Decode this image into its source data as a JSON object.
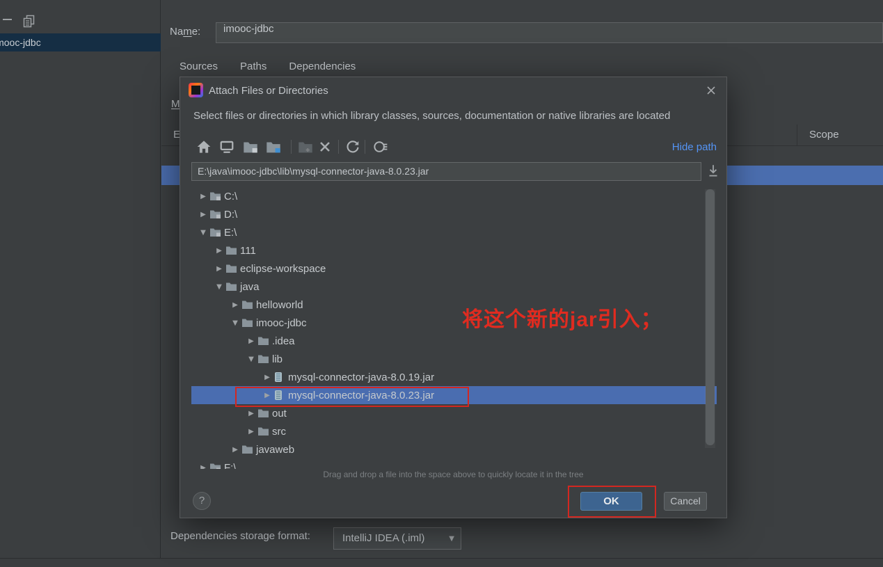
{
  "colors": {
    "background": "#3c3f41",
    "selection_blue": "#4a6db0",
    "background_row_blue": "#4b6eaf",
    "left_selection_navy": "#152e44",
    "ok_button_blue": "#3d6490",
    "link_blue": "#5494f5",
    "annotation_red": "#d32720",
    "input_background": "#45494a"
  },
  "left_panel": {
    "toolbar": {
      "minus_icon": "remove",
      "copy_icon": "copy"
    },
    "selected_item": "imooc-jdbc"
  },
  "library_editor": {
    "name_label": {
      "pre": "Na",
      "mnemonic": "m",
      "post": "e:"
    },
    "name_value": "imooc-jdbc",
    "tabs": [
      {
        "label": "Sources"
      },
      {
        "label": "Paths"
      },
      {
        "label": "Dependencies"
      }
    ],
    "clipped_module_label": "M",
    "clipped_export_label": "E",
    "scope_header": "Scope",
    "storage_format_label": "Dependencies storage format:",
    "storage_format_value": "IntelliJ IDEA (.iml)",
    "storage_dropdown_arrow": "▼"
  },
  "dialog": {
    "title": "Attach Files or Directories",
    "subtitle": "Select files or directories in which library classes, sources, documentation or native libraries are located",
    "close_icon": "close",
    "toolbar_icons": [
      "home",
      "desktop",
      "module-directory",
      "project-directory",
      "new-folder",
      "delete",
      "refresh",
      "show-hidden"
    ],
    "hide_path_link": "Hide path",
    "path_value": "E:\\java\\imooc-jdbc\\lib\\mysql-connector-java-8.0.23.jar",
    "download_icon": "paste-path",
    "tree": [
      {
        "label": "C:\\",
        "indent": 0,
        "expanded": false,
        "icon": "drive"
      },
      {
        "label": "D:\\",
        "indent": 0,
        "expanded": false,
        "icon": "drive"
      },
      {
        "label": "E:\\",
        "indent": 0,
        "expanded": true,
        "icon": "drive"
      },
      {
        "label": "111",
        "indent": 1,
        "expanded": false,
        "icon": "folder"
      },
      {
        "label": "eclipse-workspace",
        "indent": 1,
        "expanded": false,
        "icon": "folder"
      },
      {
        "label": "java",
        "indent": 1,
        "expanded": true,
        "icon": "folder"
      },
      {
        "label": "helloworld",
        "indent": 2,
        "expanded": false,
        "icon": "folder"
      },
      {
        "label": "imooc-jdbc",
        "indent": 2,
        "expanded": true,
        "icon": "folder"
      },
      {
        "label": ".idea",
        "indent": 3,
        "expanded": false,
        "icon": "folder"
      },
      {
        "label": "lib",
        "indent": 3,
        "expanded": true,
        "icon": "folder"
      },
      {
        "label": "mysql-connector-java-8.0.19.jar",
        "indent": 4,
        "expanded": false,
        "icon": "jar"
      },
      {
        "label": "mysql-connector-java-8.0.23.jar",
        "indent": 4,
        "expanded": false,
        "icon": "jar",
        "selected": true,
        "red_outline": true
      },
      {
        "label": "out",
        "indent": 3,
        "expanded": false,
        "icon": "folder"
      },
      {
        "label": "src",
        "indent": 3,
        "expanded": false,
        "icon": "folder"
      },
      {
        "label": "javaweb",
        "indent": 2,
        "expanded": false,
        "icon": "folder"
      },
      {
        "label": "F:\\",
        "indent": 0,
        "expanded": false,
        "icon": "drive",
        "clipped": true
      }
    ],
    "drag_hint": "Drag and drop a file into the space above to quickly locate it in the tree",
    "help_label": "?",
    "ok_label": "OK",
    "cancel_label": "Cancel"
  },
  "annotation": {
    "text": "将这个新的jar引入；"
  }
}
